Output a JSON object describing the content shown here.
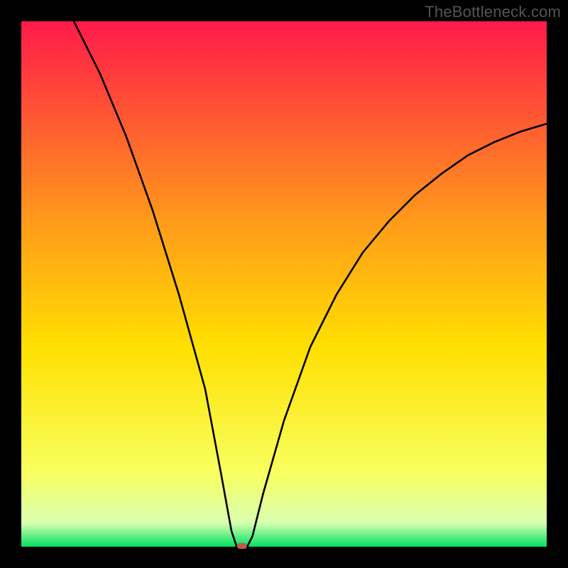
{
  "watermark": "TheBottleneck.com",
  "chart_data": {
    "type": "line",
    "title": "",
    "xlabel": "",
    "ylabel": "",
    "xlim": [
      0,
      100
    ],
    "ylim": [
      0,
      100
    ],
    "minimum_x": 42,
    "background_gradient": {
      "top": "#ff1a4a",
      "mid_upper": "#ff9a1a",
      "mid": "#ffe000",
      "mid_lower": "#f8ff60",
      "green": "#00e060"
    },
    "curve": [
      {
        "x": 10,
        "y": 100
      },
      {
        "x": 15,
        "y": 90
      },
      {
        "x": 20,
        "y": 78
      },
      {
        "x": 25,
        "y": 64
      },
      {
        "x": 30,
        "y": 48
      },
      {
        "x": 35,
        "y": 30
      },
      {
        "x": 38,
        "y": 14
      },
      {
        "x": 40,
        "y": 3
      },
      {
        "x": 41,
        "y": 0
      },
      {
        "x": 42,
        "y": 0
      },
      {
        "x": 43,
        "y": 0
      },
      {
        "x": 44,
        "y": 2
      },
      {
        "x": 46,
        "y": 10
      },
      {
        "x": 50,
        "y": 24
      },
      {
        "x": 55,
        "y": 38
      },
      {
        "x": 60,
        "y": 48
      },
      {
        "x": 65,
        "y": 56
      },
      {
        "x": 70,
        "y": 62
      },
      {
        "x": 75,
        "y": 67
      },
      {
        "x": 80,
        "y": 71
      },
      {
        "x": 85,
        "y": 74.5
      },
      {
        "x": 90,
        "y": 77
      },
      {
        "x": 95,
        "y": 79
      },
      {
        "x": 100,
        "y": 80.5
      }
    ],
    "marker": {
      "x": 42,
      "y": 0,
      "color": "#c05a4a"
    }
  }
}
